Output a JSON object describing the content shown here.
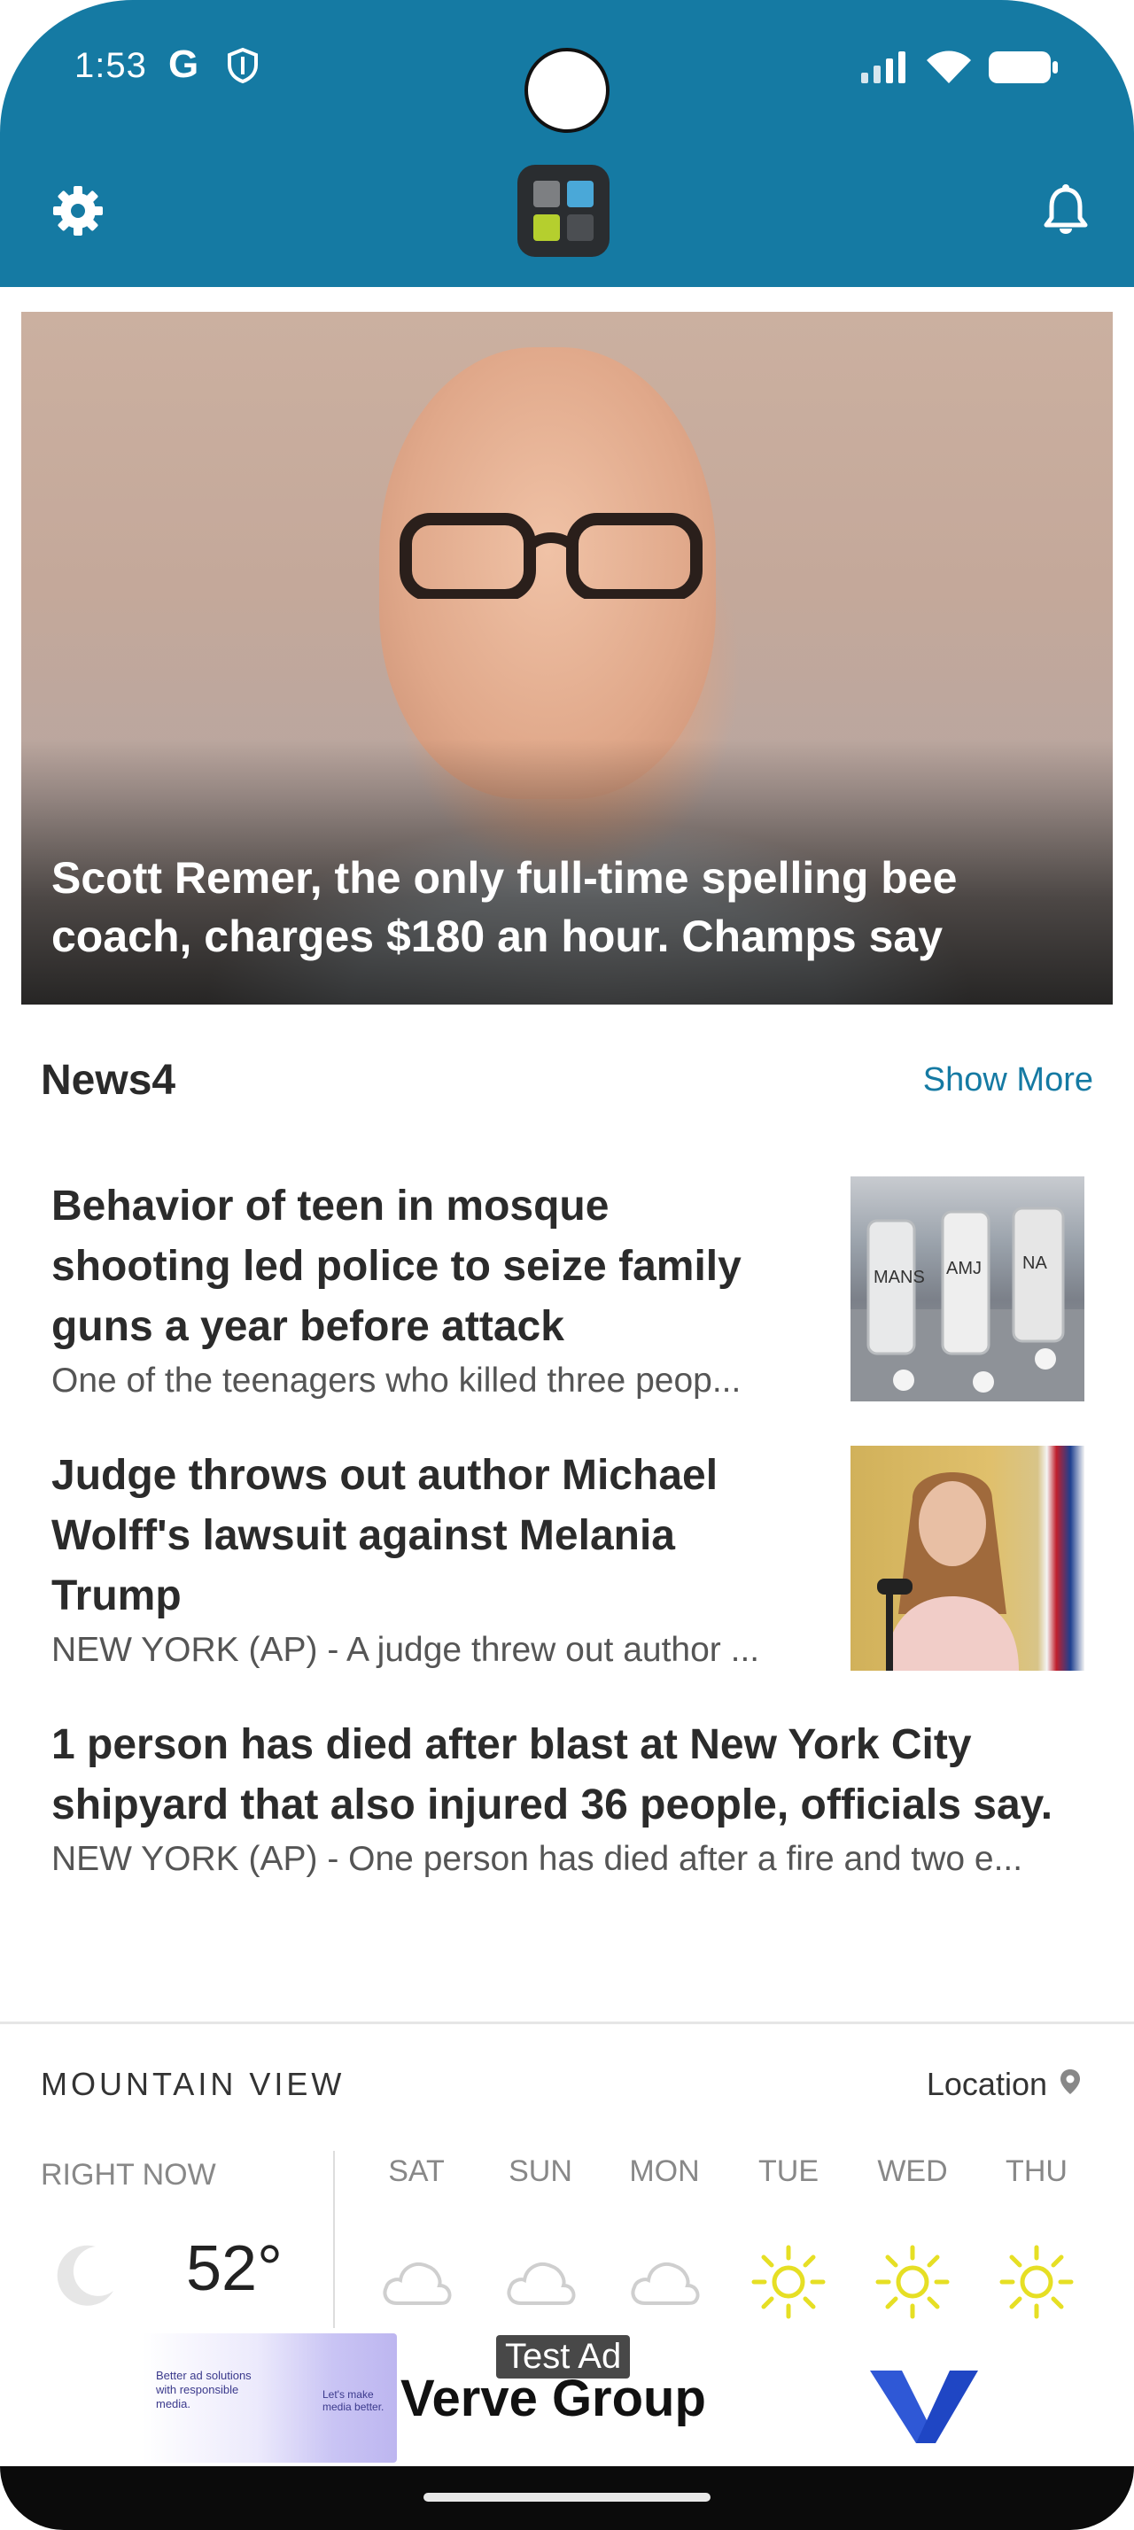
{
  "status_bar": {
    "time": "1:53",
    "left_icons": [
      "google-g-icon",
      "shield-icon"
    ],
    "right_icons": [
      "signal-icon",
      "wifi-icon",
      "battery-icon"
    ]
  },
  "header": {
    "left_icon": "gear-icon",
    "logo": "app-logo",
    "right_icon": "bell-icon",
    "background_color": "#157aa3"
  },
  "hero": {
    "title": "Scott Remer, the only full-time spelling bee coach, charges $180 an hour. Champs say"
  },
  "news_section": {
    "title": "News4",
    "show_more": "Show More",
    "articles": [
      {
        "title": "Behavior of teen in mosque shooting led police to seize family guns a year before attack",
        "summary": "One of the teenagers who  killed three peop..."
      },
      {
        "title": "Judge throws out author Michael Wolff's lawsuit against Melania Trump",
        "summary": "NEW YORK (AP) - A judge threw out author ..."
      },
      {
        "title": "1 person has died after blast at New York City shipyard that also injured 36 people, officials say.",
        "summary": "NEW YORK (AP) - One person has died after a fire and two e..."
      }
    ]
  },
  "weather": {
    "city": "MOUNTAIN VIEW",
    "location_label": "Location",
    "right_now_label": "RIGHT NOW",
    "current_temp": "52°",
    "current_icon": "moon-icon",
    "forecast": [
      {
        "day": "SAT",
        "icon": "cloud-icon"
      },
      {
        "day": "SUN",
        "icon": "cloud-icon"
      },
      {
        "day": "MON",
        "icon": "cloud-icon"
      },
      {
        "day": "TUE",
        "icon": "sun-icon"
      },
      {
        "day": "WED",
        "icon": "sun-icon"
      },
      {
        "day": "THU",
        "icon": "sun-icon"
      }
    ]
  },
  "ad": {
    "label": "Test Ad",
    "brand": "Verve Group",
    "image_headline": "Better ad solutions with responsible media.",
    "image_tagline": "Let's make media better."
  }
}
